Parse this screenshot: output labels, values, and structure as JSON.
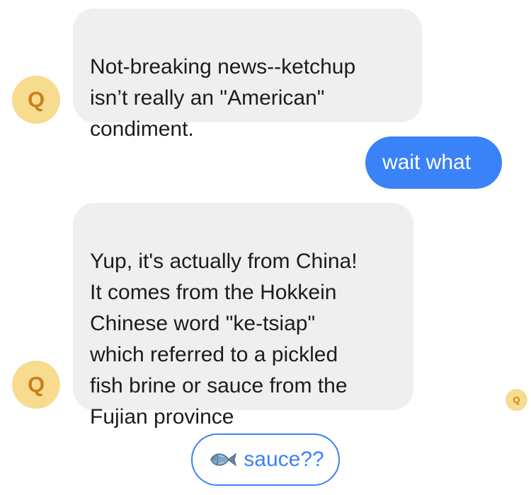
{
  "chat": {
    "bot_avatar_letter": "Q",
    "messages": [
      {
        "sender": "bot",
        "text": "Not-breaking news--ketchup\nisn’t really an \"American\"\ncondiment."
      },
      {
        "sender": "user",
        "text": "wait what"
      },
      {
        "sender": "bot",
        "text": "Yup, it's actually from China!\nIt comes from the Hokkein\nChinese word \"ke-tsiap\"\nwhich  referred to a pickled\nfish brine or sauce from the\nFujian province"
      }
    ],
    "read_receipt_letter": "Q",
    "quick_reply": {
      "icon": "fish-icon",
      "label": "sauce??"
    }
  },
  "colors": {
    "user_bubble": "#3a82f7",
    "bot_bubble": "#efefef",
    "avatar_bg": "#f7dc8f",
    "avatar_letter": "#c8801c",
    "quick_reply_border": "#3a82f7"
  }
}
